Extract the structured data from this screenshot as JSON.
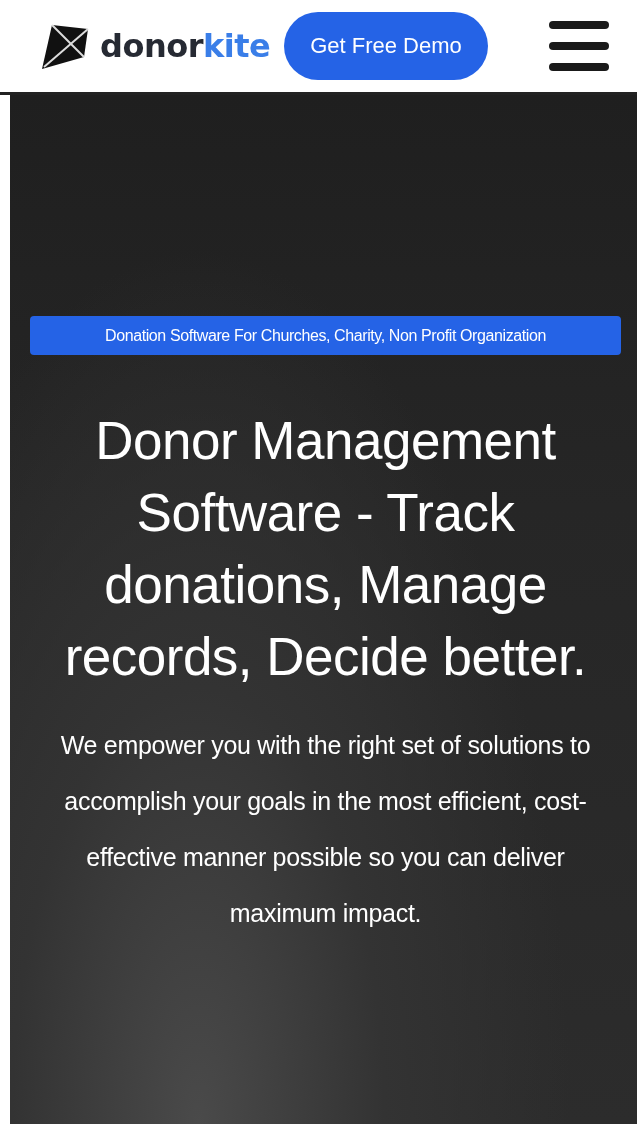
{
  "header": {
    "logo": {
      "name_dark": "donor",
      "name_accent": "kite"
    },
    "demo_button": "Get Free Demo"
  },
  "hero": {
    "badge": "Donation Software For Churches, Charity, Non Profit Organization",
    "headline": "Donor Management Software - Track donations, Manage records, Decide better.",
    "description": "We empower you with the right set of solutions to accomplish your goals in the most efficient, cost-effective manner possible so you can deliver maximum impact."
  }
}
